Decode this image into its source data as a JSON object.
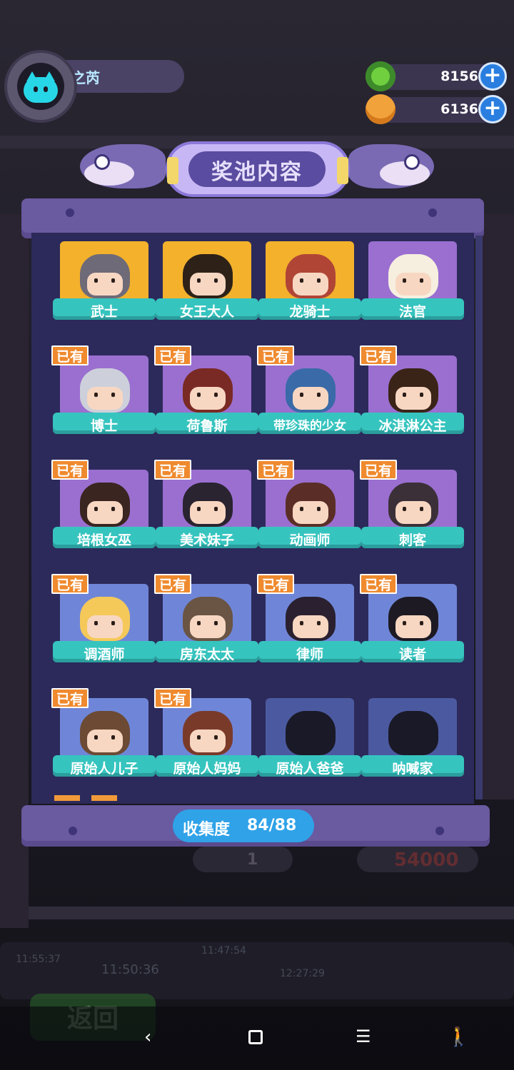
{
  "player": {
    "name": "之芮",
    "avatar_icon": "cat-icon"
  },
  "currency": [
    {
      "icon": "gear-coin-icon",
      "value": "8156",
      "color": "#7ad34a"
    },
    {
      "icon": "planet-coin-icon",
      "value": "6136",
      "color": "#f2a23a"
    }
  ],
  "panel": {
    "title": "奖池内容",
    "owned_label": "已有",
    "collection_label": "收集度",
    "collection_value": "84/88"
  },
  "characters": [
    {
      "name": "武士",
      "owned": true,
      "rarity": "legend"
    },
    {
      "name": "女王大人",
      "owned": true,
      "rarity": "legend"
    },
    {
      "name": "龙骑士",
      "owned": true,
      "rarity": "legend"
    },
    {
      "name": "法官",
      "owned": true,
      "rarity": "owned"
    },
    {
      "name": "博士",
      "owned": true,
      "rarity": "owned"
    },
    {
      "name": "荷鲁斯",
      "owned": true,
      "rarity": "owned"
    },
    {
      "name": "带珍珠的少女",
      "owned": true,
      "rarity": "owned"
    },
    {
      "name": "冰淇淋公主",
      "owned": true,
      "rarity": "owned"
    },
    {
      "name": "培根女巫",
      "owned": true,
      "rarity": "owned"
    },
    {
      "name": "美术妹子",
      "owned": true,
      "rarity": "owned"
    },
    {
      "name": "动画师",
      "owned": true,
      "rarity": "owned"
    },
    {
      "name": "刺客",
      "owned": true,
      "rarity": "owned"
    },
    {
      "name": "调酒师",
      "owned": true,
      "rarity": "blue"
    },
    {
      "name": "房东太太",
      "owned": true,
      "rarity": "blue"
    },
    {
      "name": "律师",
      "owned": true,
      "rarity": "blue"
    },
    {
      "name": "读者",
      "owned": true,
      "rarity": "blue"
    },
    {
      "name": "原始人儿子",
      "owned": true,
      "rarity": "blue"
    },
    {
      "name": "原始人妈妈",
      "owned": true,
      "rarity": "blue"
    },
    {
      "name": "原始人爸爸",
      "owned": false,
      "rarity": "locked"
    },
    {
      "name": "呐喊家",
      "owned": false,
      "rarity": "locked"
    }
  ],
  "background": {
    "back_button": "返回",
    "price": "54000",
    "count": "1",
    "timers": [
      "11:55:37",
      "11:50:36",
      "11:47:54",
      "12:27:29"
    ]
  },
  "system_nav": {
    "back": "back-icon",
    "home": "home-icon",
    "menu": "menu-icon",
    "accessibility": "accessibility-icon"
  }
}
